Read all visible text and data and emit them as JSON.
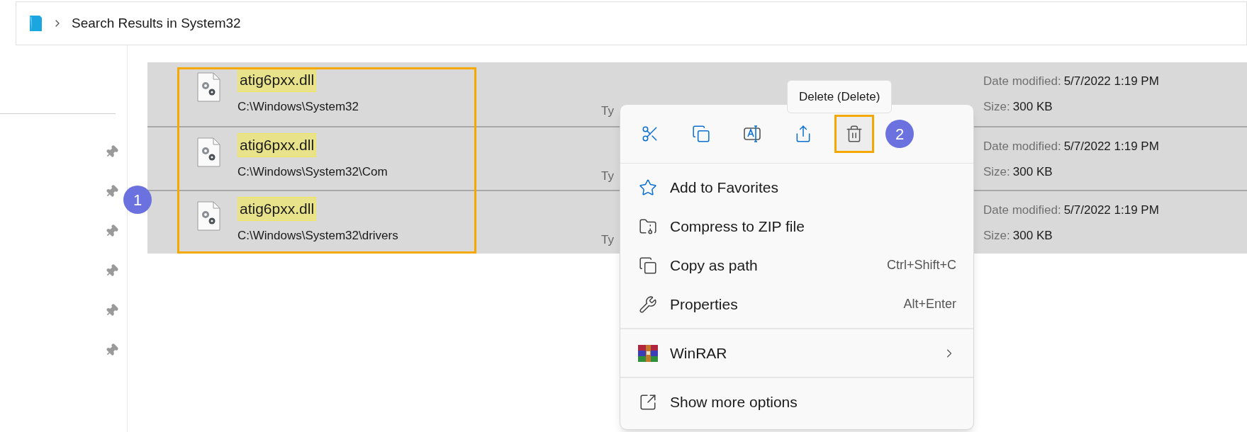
{
  "breadcrumb": {
    "location": "Search Results in System32"
  },
  "files": [
    {
      "name": "atig6pxx.dll",
      "highlighted": true,
      "path": "C:\\Windows\\System32",
      "type_text": "Ty",
      "date_label": "Date modified:",
      "date": "5/7/2022 1:19 PM",
      "size_label": "Size:",
      "size": "300 KB"
    },
    {
      "name": "atig6pxx.dll",
      "highlighted": true,
      "path": "C:\\Windows\\System32\\Com",
      "type_text": "Ty",
      "date_label": "Date modified:",
      "date": "5/7/2022 1:19 PM",
      "size_label": "Size:",
      "size": "300 KB"
    },
    {
      "name": "atig6pxx.dll",
      "highlighted": true,
      "path": "C:\\Windows\\System32\\drivers",
      "type_text": "Ty",
      "date_label": "Date modified:",
      "date": "5/7/2022 1:19 PM",
      "size_label": "Size:",
      "size": "300 KB"
    }
  ],
  "annotations": [
    {
      "label": "1"
    },
    {
      "label": "2"
    }
  ],
  "tooltip": "Delete (Delete)",
  "context_menu": {
    "toolbar": [
      {
        "hovered": false
      },
      {
        "hovered": false
      },
      {
        "hovered": false
      },
      {
        "hovered": false
      },
      {
        "hovered": true
      }
    ],
    "sections": [
      {
        "items": [
          {
            "label": "Add to Favorites",
            "submenu": false
          },
          {
            "label": "Compress to ZIP file",
            "submenu": false
          },
          {
            "label": "Copy as path",
            "shortcut": "Ctrl+Shift+C",
            "submenu": false
          },
          {
            "label": "Properties",
            "shortcut": "Alt+Enter",
            "submenu": false
          }
        ]
      },
      {
        "items": [
          {
            "label": "WinRAR",
            "submenu": true
          }
        ]
      },
      {
        "items": [
          {
            "label": "Show more options",
            "submenu": false
          }
        ]
      }
    ]
  }
}
